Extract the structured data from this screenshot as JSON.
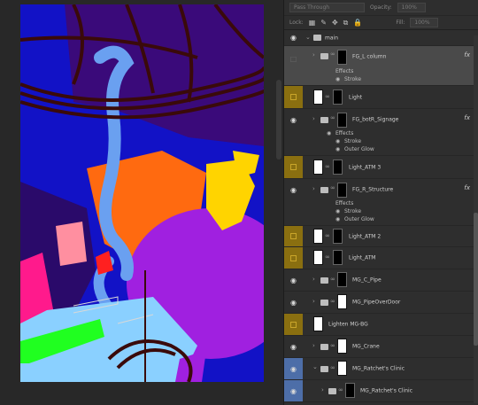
{
  "panel": {
    "blend_mode": "Pass Through",
    "opacity_label": "Opacity:",
    "opacity_value": "100%",
    "lock_label": "Lock:",
    "fill_label": "Fill:",
    "fill_value": "100%"
  },
  "layers": [
    {
      "name": "main",
      "type": "group-open"
    },
    {
      "name": "FG_L column",
      "type": "group",
      "fx": "fx",
      "effects": [
        "Effects",
        "Stroke"
      ]
    },
    {
      "name": "Light",
      "type": "layer"
    },
    {
      "name": "FG_botR_Signage",
      "type": "group",
      "fx": "fx",
      "effects": [
        "Effects",
        "Stroke",
        "Outer Glow"
      ]
    },
    {
      "name": "Light_ATM 3",
      "type": "layer"
    },
    {
      "name": "FG_R_Structure",
      "type": "group",
      "fx": "fx",
      "effects": [
        "Effects",
        "Stroke",
        "Outer Glow"
      ]
    },
    {
      "name": "Light_ATM 2",
      "type": "layer"
    },
    {
      "name": "Light_ATM",
      "type": "layer"
    },
    {
      "name": "MG_C_Pipe",
      "type": "group"
    },
    {
      "name": "MG_PipeOverDoor",
      "type": "group"
    },
    {
      "name": "Lighten MG-BG",
      "type": "layer"
    },
    {
      "name": "MG_Crane",
      "type": "group"
    },
    {
      "name": "MG_Ratchet's Clinic",
      "type": "group-open"
    },
    {
      "name": "MG_Ratchet's Clinic",
      "type": "group"
    }
  ],
  "colors": {
    "canvas_bg": "#1010c8",
    "purple": "#3a0a7a",
    "violet_blob": "#a020e0",
    "orange": "#ff6a10",
    "yellow": "#ffd400",
    "pipe_blue": "#6aa0f0",
    "pink": "#ff1a8c",
    "light_blue": "#8ad0ff",
    "green": "#20ff20",
    "dark_lines": "#3a0a0a"
  }
}
